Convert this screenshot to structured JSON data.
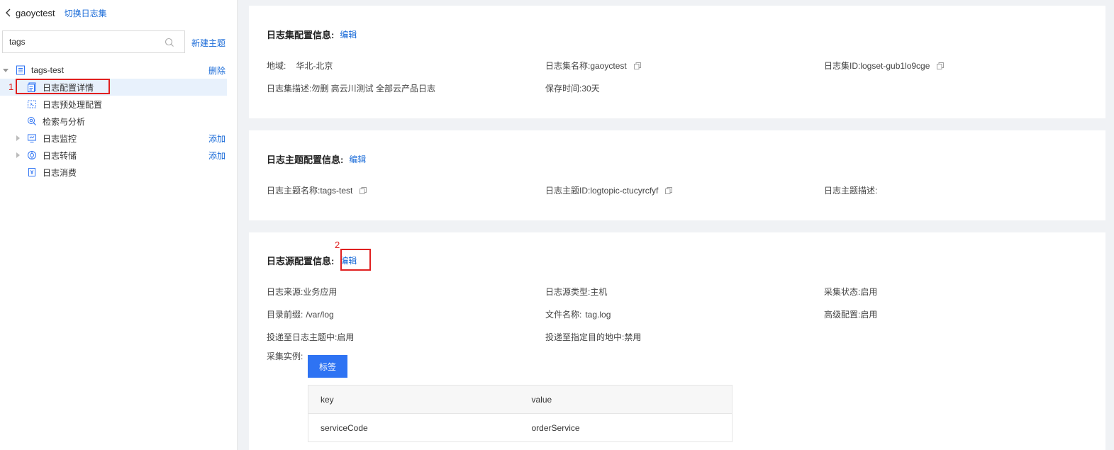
{
  "sidebar": {
    "logset_name": "gaoyctest",
    "switch_label": "切换日志集",
    "search": {
      "value": "tags",
      "placeholder": ""
    },
    "new_topic_label": "新建主题",
    "topic": {
      "name": "tags-test",
      "delete_label": "删除"
    },
    "items": [
      {
        "label": "日志配置详情",
        "selected": true
      },
      {
        "label": "日志预处理配置"
      },
      {
        "label": "检索与分析"
      },
      {
        "label": "日志监控",
        "action": "添加"
      },
      {
        "label": "日志转储",
        "action": "添加"
      },
      {
        "label": "日志消费"
      }
    ]
  },
  "annotations": {
    "mark1": "1",
    "mark2": "2"
  },
  "logset_panel": {
    "title": "日志集配置信息:",
    "edit_label": "编辑",
    "region_label": "地域:",
    "region_value": "华北-北京",
    "name_field": "日志集名称:gaoyctest",
    "id_field": "日志集ID:logset-gub1lo9cge",
    "desc_field": "日志集描述:勿删 高云川测试 全部云产品日志",
    "retention_field": "保存时间:30天"
  },
  "topic_panel": {
    "title": "日志主题配置信息:",
    "edit_label": "编辑",
    "name_field": "日志主题名称:tags-test",
    "id_field": "日志主题ID:logtopic-ctucyrcfyf",
    "desc_field": "日志主题描述:"
  },
  "source_panel": {
    "title": "日志源配置信息:",
    "edit_label": "编辑",
    "source_field": "日志来源:业务应用",
    "type_field": "日志源类型:主机",
    "status_field": "采集状态:启用",
    "dir_prefix_label": "目录前缀:",
    "dir_prefix_value": "/var/log",
    "filename_label": "文件名称:",
    "filename_value": "tag.log",
    "advanced_field": "高级配置:启用",
    "deliver_topic_field": "投递至日志主题中:启用",
    "deliver_dest_field": "投递至指定目的地中:禁用",
    "instance_label": "采集实例:",
    "tag_button": "标签",
    "table": {
      "headers": [
        "key",
        "value"
      ],
      "rows": [
        [
          "serviceCode",
          "orderService"
        ]
      ]
    }
  }
}
